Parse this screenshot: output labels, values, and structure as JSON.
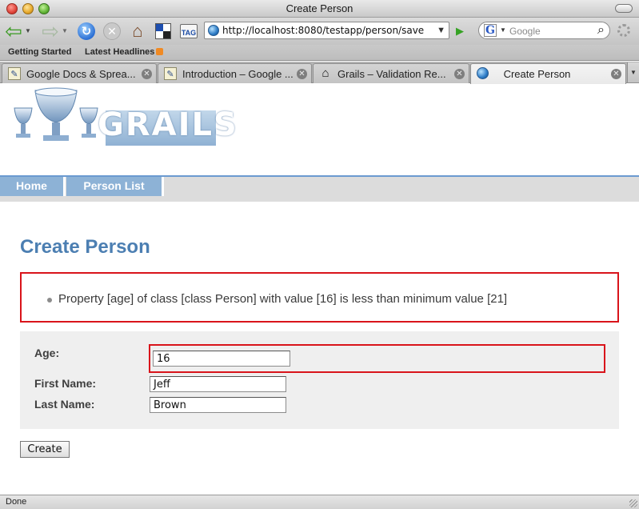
{
  "window": {
    "title": "Create Person"
  },
  "toolbar": {
    "back_icon": "⇦",
    "forward_icon": "⇨",
    "dropdown_glyph": "▼",
    "reload_icon": "↻",
    "stop_icon": "✕",
    "home_icon": "⌂",
    "tag_label": "TAG",
    "url": "http://localhost:8080/testapp/person/save",
    "go_icon": "▶",
    "search_engine_letter": "G",
    "search_placeholder": "Google",
    "search_icon": "⌕"
  },
  "bookmarks": [
    {
      "label": "Getting Started"
    },
    {
      "label": "Latest Headlines"
    }
  ],
  "tabs": [
    {
      "label": "Google Docs & Sprea...",
      "icon": "document-icon",
      "active": false
    },
    {
      "label": "Introduction – Google ...",
      "icon": "document-icon",
      "active": false
    },
    {
      "label": "Grails – Validation Re...",
      "icon": "house-icon",
      "active": false
    },
    {
      "label": "Create Person",
      "icon": "globe-icon",
      "active": true
    }
  ],
  "tab_close_glyph": "✕",
  "tab_doc_glyph": "✎",
  "tab_house_glyph": "⌂",
  "tab_menu_glyph": "▼",
  "page": {
    "logo_text": "GRAILS",
    "nav": [
      {
        "label": "Home"
      },
      {
        "label": "Person List"
      }
    ],
    "title": "Create Person",
    "errors": [
      "Property [age] of class [class Person] with value [16] is less than minimum value [21]"
    ],
    "form": {
      "age_label": "Age:",
      "age_value": "16",
      "first_name_label": "First Name:",
      "first_name_value": "Jeff",
      "last_name_label": "Last Name:",
      "last_name_value": "Brown"
    },
    "create_button_label": "Create"
  },
  "status": {
    "text": "Done"
  },
  "colors": {
    "error_border": "#d9141b",
    "title_blue": "#4c7fb2",
    "nav_tab": "#8db2d6"
  }
}
